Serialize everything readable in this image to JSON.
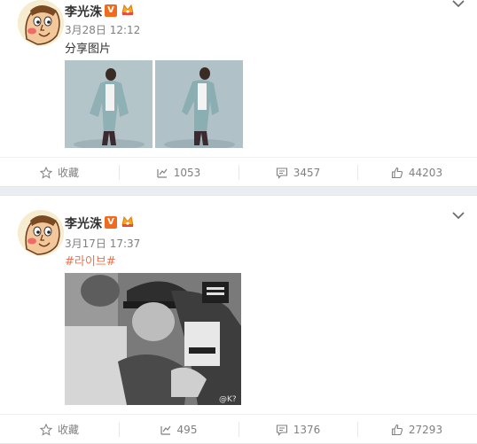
{
  "posts": [
    {
      "author": "李光洙",
      "verified_badge": "V",
      "time": "3月28日 12:12",
      "text": "分享图片",
      "actions": {
        "favorite_label": "收藏",
        "repost_count": "1053",
        "comment_count": "3457",
        "like_count": "44203"
      }
    },
    {
      "author": "李光洙",
      "verified_badge": "V",
      "time": "3月17日 17:37",
      "text": "#라이브#",
      "watermark": "@K?",
      "actions": {
        "favorite_label": "收藏",
        "repost_count": "495",
        "comment_count": "1376",
        "like_count": "27293"
      }
    }
  ],
  "colors": {
    "accent_orange": "#eb7350",
    "badge_orange": "#f16b1f",
    "muted_text": "#808080"
  },
  "icons": [
    "avatar-cartoon",
    "verified-v-icon",
    "medal-icon",
    "chevron-down-icon",
    "star-icon",
    "repost-icon",
    "comment-icon",
    "like-icon"
  ]
}
